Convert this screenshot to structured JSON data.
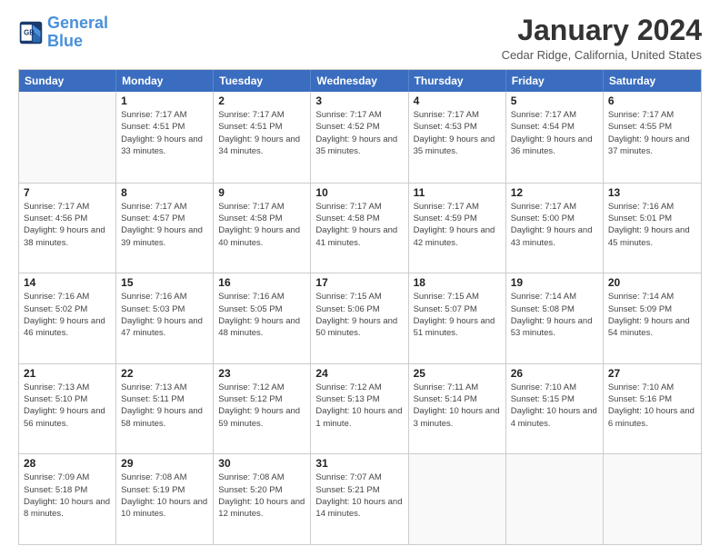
{
  "logo": {
    "line1": "General",
    "line2": "Blue"
  },
  "header": {
    "title": "January 2024",
    "location": "Cedar Ridge, California, United States"
  },
  "weekdays": [
    "Sunday",
    "Monday",
    "Tuesday",
    "Wednesday",
    "Thursday",
    "Friday",
    "Saturday"
  ],
  "weeks": [
    [
      {
        "day": "",
        "sunrise": "",
        "sunset": "",
        "daylight": ""
      },
      {
        "day": "1",
        "sunrise": "Sunrise: 7:17 AM",
        "sunset": "Sunset: 4:51 PM",
        "daylight": "Daylight: 9 hours and 33 minutes."
      },
      {
        "day": "2",
        "sunrise": "Sunrise: 7:17 AM",
        "sunset": "Sunset: 4:51 PM",
        "daylight": "Daylight: 9 hours and 34 minutes."
      },
      {
        "day": "3",
        "sunrise": "Sunrise: 7:17 AM",
        "sunset": "Sunset: 4:52 PM",
        "daylight": "Daylight: 9 hours and 35 minutes."
      },
      {
        "day": "4",
        "sunrise": "Sunrise: 7:17 AM",
        "sunset": "Sunset: 4:53 PM",
        "daylight": "Daylight: 9 hours and 35 minutes."
      },
      {
        "day": "5",
        "sunrise": "Sunrise: 7:17 AM",
        "sunset": "Sunset: 4:54 PM",
        "daylight": "Daylight: 9 hours and 36 minutes."
      },
      {
        "day": "6",
        "sunrise": "Sunrise: 7:17 AM",
        "sunset": "Sunset: 4:55 PM",
        "daylight": "Daylight: 9 hours and 37 minutes."
      }
    ],
    [
      {
        "day": "7",
        "sunrise": "Sunrise: 7:17 AM",
        "sunset": "Sunset: 4:56 PM",
        "daylight": "Daylight: 9 hours and 38 minutes."
      },
      {
        "day": "8",
        "sunrise": "Sunrise: 7:17 AM",
        "sunset": "Sunset: 4:57 PM",
        "daylight": "Daylight: 9 hours and 39 minutes."
      },
      {
        "day": "9",
        "sunrise": "Sunrise: 7:17 AM",
        "sunset": "Sunset: 4:58 PM",
        "daylight": "Daylight: 9 hours and 40 minutes."
      },
      {
        "day": "10",
        "sunrise": "Sunrise: 7:17 AM",
        "sunset": "Sunset: 4:58 PM",
        "daylight": "Daylight: 9 hours and 41 minutes."
      },
      {
        "day": "11",
        "sunrise": "Sunrise: 7:17 AM",
        "sunset": "Sunset: 4:59 PM",
        "daylight": "Daylight: 9 hours and 42 minutes."
      },
      {
        "day": "12",
        "sunrise": "Sunrise: 7:17 AM",
        "sunset": "Sunset: 5:00 PM",
        "daylight": "Daylight: 9 hours and 43 minutes."
      },
      {
        "day": "13",
        "sunrise": "Sunrise: 7:16 AM",
        "sunset": "Sunset: 5:01 PM",
        "daylight": "Daylight: 9 hours and 45 minutes."
      }
    ],
    [
      {
        "day": "14",
        "sunrise": "Sunrise: 7:16 AM",
        "sunset": "Sunset: 5:02 PM",
        "daylight": "Daylight: 9 hours and 46 minutes."
      },
      {
        "day": "15",
        "sunrise": "Sunrise: 7:16 AM",
        "sunset": "Sunset: 5:03 PM",
        "daylight": "Daylight: 9 hours and 47 minutes."
      },
      {
        "day": "16",
        "sunrise": "Sunrise: 7:16 AM",
        "sunset": "Sunset: 5:05 PM",
        "daylight": "Daylight: 9 hours and 48 minutes."
      },
      {
        "day": "17",
        "sunrise": "Sunrise: 7:15 AM",
        "sunset": "Sunset: 5:06 PM",
        "daylight": "Daylight: 9 hours and 50 minutes."
      },
      {
        "day": "18",
        "sunrise": "Sunrise: 7:15 AM",
        "sunset": "Sunset: 5:07 PM",
        "daylight": "Daylight: 9 hours and 51 minutes."
      },
      {
        "day": "19",
        "sunrise": "Sunrise: 7:14 AM",
        "sunset": "Sunset: 5:08 PM",
        "daylight": "Daylight: 9 hours and 53 minutes."
      },
      {
        "day": "20",
        "sunrise": "Sunrise: 7:14 AM",
        "sunset": "Sunset: 5:09 PM",
        "daylight": "Daylight: 9 hours and 54 minutes."
      }
    ],
    [
      {
        "day": "21",
        "sunrise": "Sunrise: 7:13 AM",
        "sunset": "Sunset: 5:10 PM",
        "daylight": "Daylight: 9 hours and 56 minutes."
      },
      {
        "day": "22",
        "sunrise": "Sunrise: 7:13 AM",
        "sunset": "Sunset: 5:11 PM",
        "daylight": "Daylight: 9 hours and 58 minutes."
      },
      {
        "day": "23",
        "sunrise": "Sunrise: 7:12 AM",
        "sunset": "Sunset: 5:12 PM",
        "daylight": "Daylight: 9 hours and 59 minutes."
      },
      {
        "day": "24",
        "sunrise": "Sunrise: 7:12 AM",
        "sunset": "Sunset: 5:13 PM",
        "daylight": "Daylight: 10 hours and 1 minute."
      },
      {
        "day": "25",
        "sunrise": "Sunrise: 7:11 AM",
        "sunset": "Sunset: 5:14 PM",
        "daylight": "Daylight: 10 hours and 3 minutes."
      },
      {
        "day": "26",
        "sunrise": "Sunrise: 7:10 AM",
        "sunset": "Sunset: 5:15 PM",
        "daylight": "Daylight: 10 hours and 4 minutes."
      },
      {
        "day": "27",
        "sunrise": "Sunrise: 7:10 AM",
        "sunset": "Sunset: 5:16 PM",
        "daylight": "Daylight: 10 hours and 6 minutes."
      }
    ],
    [
      {
        "day": "28",
        "sunrise": "Sunrise: 7:09 AM",
        "sunset": "Sunset: 5:18 PM",
        "daylight": "Daylight: 10 hours and 8 minutes."
      },
      {
        "day": "29",
        "sunrise": "Sunrise: 7:08 AM",
        "sunset": "Sunset: 5:19 PM",
        "daylight": "Daylight: 10 hours and 10 minutes."
      },
      {
        "day": "30",
        "sunrise": "Sunrise: 7:08 AM",
        "sunset": "Sunset: 5:20 PM",
        "daylight": "Daylight: 10 hours and 12 minutes."
      },
      {
        "day": "31",
        "sunrise": "Sunrise: 7:07 AM",
        "sunset": "Sunset: 5:21 PM",
        "daylight": "Daylight: 10 hours and 14 minutes."
      },
      {
        "day": "",
        "sunrise": "",
        "sunset": "",
        "daylight": ""
      },
      {
        "day": "",
        "sunrise": "",
        "sunset": "",
        "daylight": ""
      },
      {
        "day": "",
        "sunrise": "",
        "sunset": "",
        "daylight": ""
      }
    ]
  ]
}
